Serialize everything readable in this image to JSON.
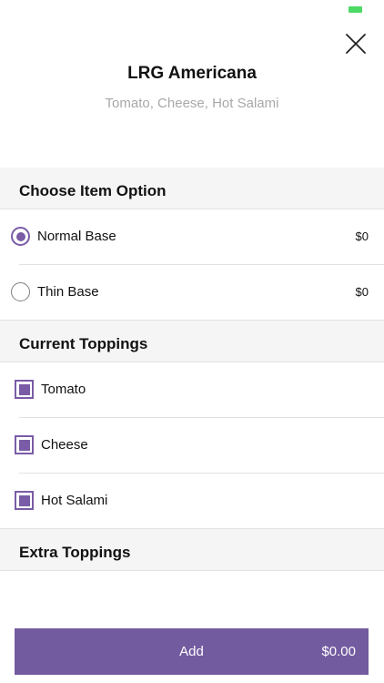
{
  "status_bar": {
    "battery_color": "#4cd964"
  },
  "header": {
    "title": "LRG Americana",
    "subtitle": "Tomato, Cheese, Hot Salami",
    "close_icon": "close-icon"
  },
  "item_options": {
    "heading": "Choose Item Option",
    "options": [
      {
        "label": "Normal Base",
        "price": "$0",
        "selected": true
      },
      {
        "label": "Thin Base",
        "price": "$0",
        "selected": false
      }
    ]
  },
  "current_toppings": {
    "heading": "Current Toppings",
    "items": [
      {
        "label": "Tomato",
        "checked": true
      },
      {
        "label": "Cheese",
        "checked": true
      },
      {
        "label": "Hot Salami",
        "checked": true
      }
    ]
  },
  "extra_toppings": {
    "heading": "Extra Toppings"
  },
  "footer": {
    "add_label": "Add",
    "total": "$0.00"
  },
  "colors": {
    "accent": "#7a5ba6",
    "add_bar": "#735ba0",
    "section_bg": "#f5f5f5",
    "subtitle": "#a8a8a8"
  }
}
